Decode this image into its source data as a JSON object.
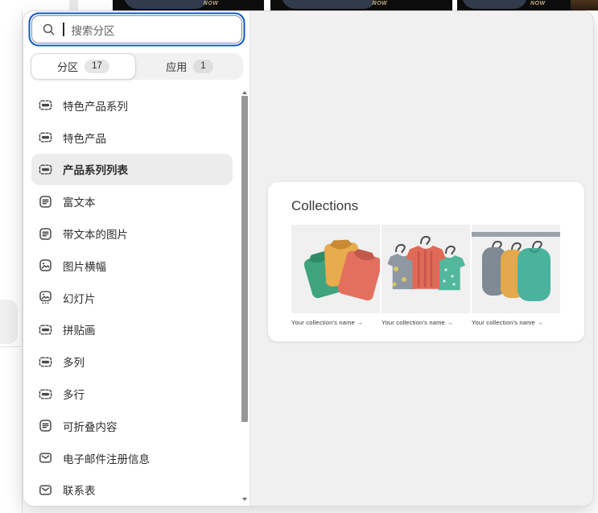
{
  "background": {
    "thumbnails": [
      {
        "cta": "NOW"
      },
      {
        "cta": "NOW"
      },
      {
        "cta": "NOW"
      }
    ]
  },
  "popover": {
    "search": {
      "placeholder": "搜索分区"
    },
    "tabs": [
      {
        "label": "分区",
        "count": "17",
        "selected": true
      },
      {
        "label": "应用",
        "count": "1",
        "selected": false
      }
    ],
    "sections": [
      {
        "label": "特色产品系列",
        "icon": "section-icon",
        "active": false
      },
      {
        "label": "特色产品",
        "icon": "section-icon",
        "active": false
      },
      {
        "label": "产品系列列表",
        "icon": "section-icon",
        "active": true
      },
      {
        "label": "富文本",
        "icon": "text-block-icon",
        "active": false
      },
      {
        "label": "带文本的图片",
        "icon": "text-block-icon",
        "active": false
      },
      {
        "label": "图片横幅",
        "icon": "image-icon",
        "active": false
      },
      {
        "label": "幻灯片",
        "icon": "slideshow-icon",
        "active": false
      },
      {
        "label": "拼贴画",
        "icon": "section-icon",
        "active": false
      },
      {
        "label": "多列",
        "icon": "section-icon",
        "active": false
      },
      {
        "label": "多行",
        "icon": "section-icon",
        "active": false
      },
      {
        "label": "可折叠内容",
        "icon": "text-block-icon",
        "active": false
      },
      {
        "label": "电子邮件注册信息",
        "icon": "envelope-icon",
        "active": false
      },
      {
        "label": "联系表",
        "icon": "envelope-icon",
        "active": false
      }
    ]
  },
  "preview": {
    "title": "Collections",
    "items": [
      {
        "caption": "Your collection's name  →",
        "illustration": "folded-shirts"
      },
      {
        "caption": "Your collection's name  →",
        "illustration": "hanging-shirts"
      },
      {
        "caption": "Your collection's name  →",
        "illustration": "clothes-rack"
      }
    ]
  },
  "colors": {
    "focus_ring": "#0b57d0",
    "active_item_bg": "#ececec",
    "panel_grey": "#f0f0f1"
  }
}
